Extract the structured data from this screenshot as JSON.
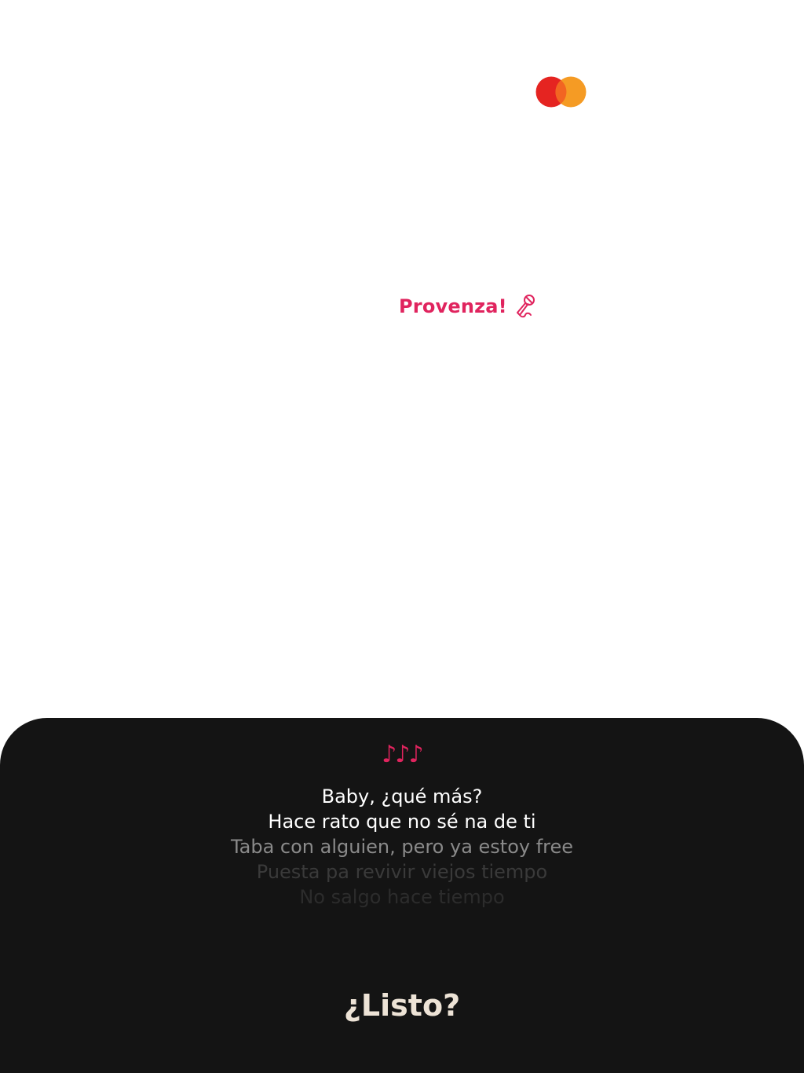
{
  "brand": {
    "icon": "mastercard-logo",
    "colors": {
      "left": "#e52421",
      "right": "#f59b24",
      "overlap": "#f26522"
    }
  },
  "song": {
    "title": "Provenza!",
    "icon": "microphone-icon",
    "accent_color": "#e0245e"
  },
  "lyrics_panel": {
    "notes": "♪♪♪",
    "lines": [
      "Baby, ¿qué más?",
      "Hace rato que no sé na de ti",
      "Taba con alguien, pero ya estoy free",
      "Puesta pa revivir viejos tiempo",
      "No salgo hace tiempo"
    ],
    "prompt": "¿Listo?",
    "background": "#141414"
  }
}
